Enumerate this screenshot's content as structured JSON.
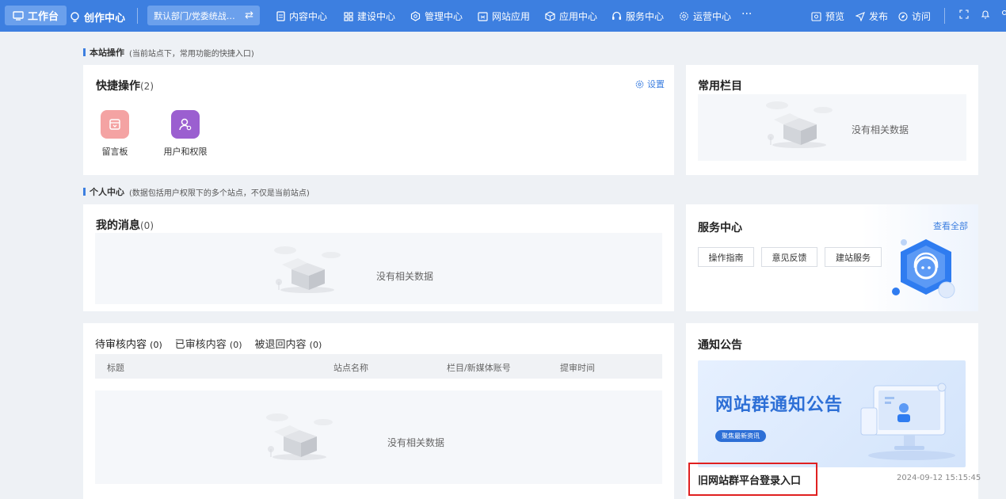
{
  "topnav": {
    "workbench": "工作台",
    "create": "创作中心",
    "dept": "默认部门/党委统战部...",
    "menu": [
      "内容中心",
      "建设中心",
      "管理中心",
      "网站应用",
      "应用中心",
      "服务中心",
      "运营中心"
    ],
    "more": "···",
    "preview": "预览",
    "publish": "发布",
    "visit": "访问"
  },
  "site_ops": {
    "title": "本站操作",
    "sub": "(当前站点下，常用功能的快捷入口)"
  },
  "quick_ops": {
    "title": "快捷操作",
    "count": "(2)",
    "settings": "设置",
    "items": [
      {
        "label": "留言板",
        "color": "#f4a3a3"
      },
      {
        "label": "用户和权限",
        "color": "#9b5fd0"
      }
    ]
  },
  "common_columns": {
    "title": "常用栏目",
    "empty": "没有相关数据"
  },
  "personal": {
    "title": "个人中心",
    "sub": "(数据包括用户权限下的多个站点，不仅是当前站点)"
  },
  "messages": {
    "title": "我的消息",
    "count": "(0)",
    "empty": "没有相关数据"
  },
  "service": {
    "title": "服务中心",
    "view_all": "查看全部",
    "buttons": [
      "操作指南",
      "意见反馈",
      "建站服务"
    ]
  },
  "review": {
    "tabs": [
      {
        "label": "待审核内容",
        "count": "(0)"
      },
      {
        "label": "已审核内容",
        "count": "(0)"
      },
      {
        "label": "被退回内容",
        "count": "(0)"
      }
    ],
    "columns": [
      "标题",
      "站点名称",
      "栏目/新媒体账号",
      "提审时间"
    ],
    "empty": "没有相关数据"
  },
  "notice": {
    "title": "通知公告",
    "banner_title": "网站群通知公告",
    "banner_pill": "聚焦最新资讯",
    "item_title": "旧网站群平台登录入口",
    "item_date": "2024-09-12 15:15:45"
  },
  "colors": {
    "brand": "#3d7fe0",
    "highlight": "#e02020"
  }
}
